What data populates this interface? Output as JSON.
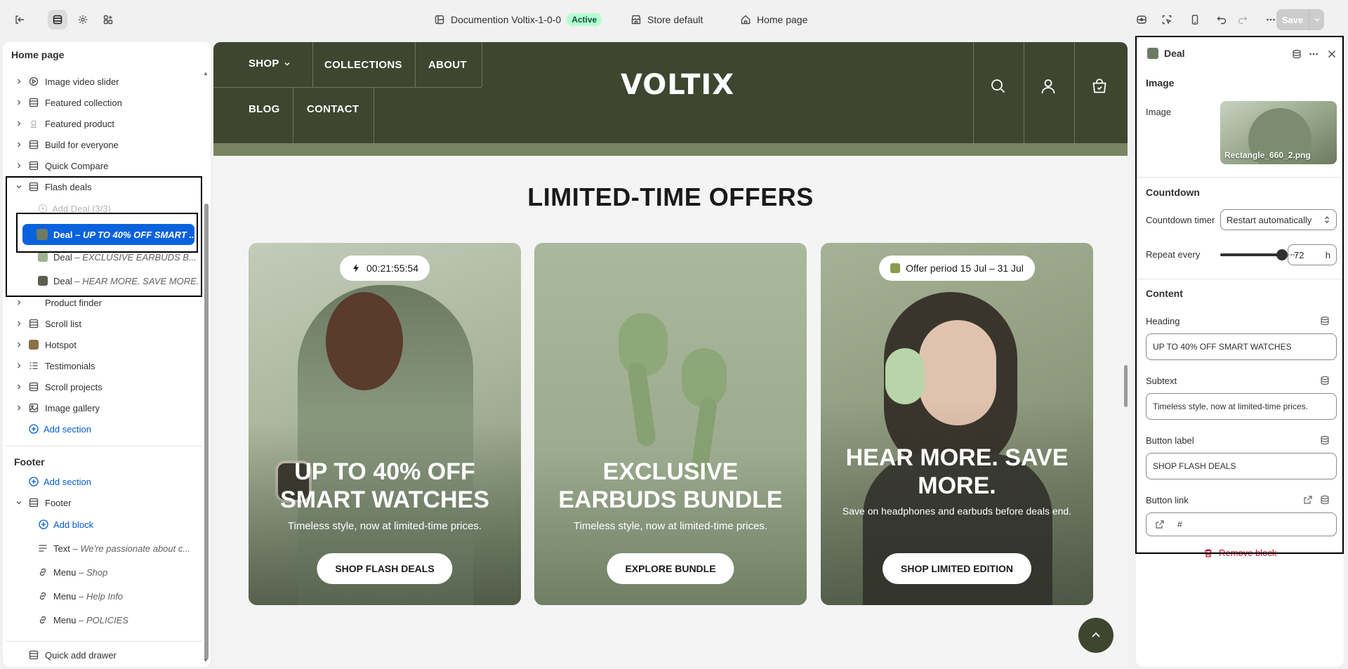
{
  "topbar": {
    "theme_name": "Documention Voltix-1-0-0",
    "status_badge": "Active",
    "store": "Store default",
    "page": "Home page",
    "save_label": "Save"
  },
  "sidebar": {
    "title": "Home page",
    "sections": [
      {
        "label": "Image video slider",
        "icon": "slider-icon"
      },
      {
        "label": "Featured collection",
        "icon": "section-icon"
      },
      {
        "label": "Featured product",
        "icon": "product-icon"
      },
      {
        "label": "Build for everyone",
        "icon": "section-icon"
      },
      {
        "label": "Quick Compare",
        "icon": "section-icon"
      }
    ],
    "flash_deals": {
      "label": "Flash deals",
      "add_deal": "Add Deal (3/3)",
      "deals": [
        {
          "label": "Deal",
          "sub": "UP TO 40% OFF SMART ..."
        },
        {
          "label": "Deal",
          "sub": "EXCLUSIVE EARBUDS B..."
        },
        {
          "label": "Deal",
          "sub": "HEAR MORE. SAVE MORE."
        }
      ]
    },
    "sections_after": [
      {
        "label": "Product finder"
      },
      {
        "label": "Scroll list"
      },
      {
        "label": "Hotspot"
      },
      {
        "label": "Testimonials"
      },
      {
        "label": "Scroll projects"
      },
      {
        "label": "Image gallery"
      }
    ],
    "add_section": "Add section",
    "footer_group": "Footer",
    "footer_add_section": "Add section",
    "footer": {
      "label": "Footer",
      "add_block": "Add block",
      "blocks": [
        {
          "label": "Text",
          "sub": "We're passionate about c..."
        },
        {
          "label": "Menu",
          "sub": "Shop"
        },
        {
          "label": "Menu",
          "sub": "Help Info"
        },
        {
          "label": "Menu",
          "sub": "POLICIES"
        }
      ]
    },
    "quick_add": "Quick add drawer"
  },
  "preview": {
    "nav": {
      "shop": "SHOP",
      "collections": "COLLECTIONS",
      "about": "ABOUT",
      "blog": "BLOG",
      "contact": "CONTACT"
    },
    "logo": "VOLTIX",
    "section_title": "LIMITED-TIME OFFERS",
    "cards": [
      {
        "pill": "00:21:55:54",
        "heading": "UP TO 40% OFF SMART WATCHES",
        "subtext": "Timeless style, now at limited-time prices.",
        "button": "SHOP FLASH DEALS"
      },
      {
        "pill": "",
        "heading": "EXCLUSIVE EARBUDS BUNDLE",
        "subtext": "Timeless style, now at limited-time prices.",
        "button": "EXPLORE BUNDLE"
      },
      {
        "pill": "Offer period 15 Jul – 31 Jul",
        "heading": "HEAR MORE. SAVE MORE.",
        "subtext": "Save on headphones and earbuds before deals end.",
        "button": "SHOP LIMITED EDITION"
      }
    ]
  },
  "settings": {
    "title": "Deal",
    "image_section": "Image",
    "image_label": "Image",
    "image_filename": "Rectangle_660_2.png",
    "countdown_section": "Countdown",
    "countdown_timer_label": "Countdown timer",
    "countdown_timer_value": "Restart automatically",
    "repeat_label": "Repeat every",
    "repeat_value": "72",
    "repeat_unit": "h",
    "content_section": "Content",
    "heading_label": "Heading",
    "heading_value": "UP TO 40% OFF SMART WATCHES",
    "subtext_label": "Subtext",
    "subtext_value": "Timeless style, now at limited-time prices.",
    "button_label_label": "Button label",
    "button_label_value": "SHOP FLASH DEALS",
    "button_link_label": "Button link",
    "button_link_value": "#",
    "remove_block": "Remove block"
  },
  "colors": {
    "accent": "#005bd3",
    "selected": "#0a62dd",
    "header_bg": "#3e4630",
    "danger": "#c70a24"
  }
}
